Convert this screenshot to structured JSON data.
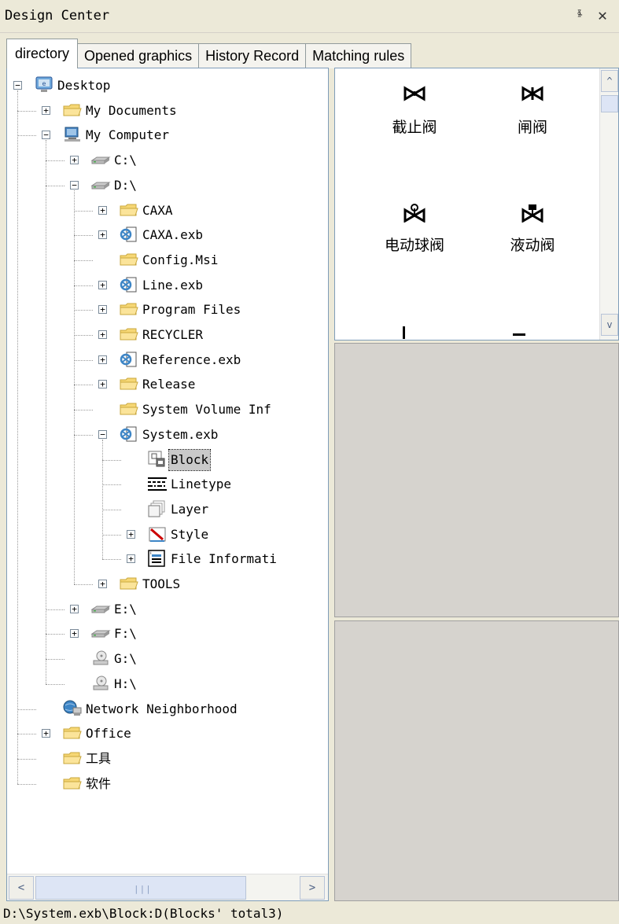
{
  "window": {
    "title": "Design Center",
    "pin_glyph": "ⱛ",
    "close_glyph": "✕"
  },
  "tabs": [
    {
      "label": "directory",
      "active": true
    },
    {
      "label": "Opened graphics",
      "active": false
    },
    {
      "label": "History Record",
      "active": false
    },
    {
      "label": "Matching rules",
      "active": false
    }
  ],
  "tree": [
    {
      "id": "desktop",
      "label": "Desktop",
      "icon": "desktop-icon",
      "level": 0,
      "expander": "minus"
    },
    {
      "id": "my-documents",
      "label": "My Documents",
      "icon": "folder-icon",
      "level": 1,
      "expander": "plus"
    },
    {
      "id": "my-computer",
      "label": "My Computer",
      "icon": "computer-icon",
      "level": 1,
      "expander": "minus"
    },
    {
      "id": "drive-c",
      "label": "C:\\",
      "icon": "drive-icon",
      "level": 2,
      "expander": "plus"
    },
    {
      "id": "drive-d",
      "label": "D:\\",
      "icon": "drive-icon",
      "level": 2,
      "expander": "minus"
    },
    {
      "id": "caxa",
      "label": "CAXA",
      "icon": "folder-icon",
      "level": 3,
      "expander": "plus"
    },
    {
      "id": "caxa-exb",
      "label": "CAXA.exb",
      "icon": "exb-file-icon",
      "level": 3,
      "expander": "plus"
    },
    {
      "id": "config-msi",
      "label": "Config.Msi",
      "icon": "folder-icon",
      "level": 3,
      "expander": "none"
    },
    {
      "id": "line-exb",
      "label": "Line.exb",
      "icon": "exb-file-icon",
      "level": 3,
      "expander": "plus"
    },
    {
      "id": "program-files",
      "label": "Program Files",
      "icon": "folder-icon",
      "level": 3,
      "expander": "plus"
    },
    {
      "id": "recycler",
      "label": "RECYCLER",
      "icon": "folder-icon",
      "level": 3,
      "expander": "plus"
    },
    {
      "id": "reference-exb",
      "label": "Reference.exb",
      "icon": "exb-file-icon",
      "level": 3,
      "expander": "plus"
    },
    {
      "id": "release",
      "label": "Release",
      "icon": "folder-icon",
      "level": 3,
      "expander": "plus"
    },
    {
      "id": "system-volume",
      "label": "System Volume Inf",
      "icon": "folder-icon",
      "level": 3,
      "expander": "none"
    },
    {
      "id": "system-exb",
      "label": "System.exb",
      "icon": "exb-file-icon",
      "level": 3,
      "expander": "minus"
    },
    {
      "id": "block",
      "label": "Block",
      "icon": "block-icon",
      "level": 4,
      "expander": "none",
      "selected": true
    },
    {
      "id": "linetype",
      "label": "Linetype",
      "icon": "linetype-icon",
      "level": 4,
      "expander": "none"
    },
    {
      "id": "layer",
      "label": "Layer",
      "icon": "layer-icon",
      "level": 4,
      "expander": "none"
    },
    {
      "id": "style",
      "label": "Style",
      "icon": "style-icon",
      "level": 4,
      "expander": "plus"
    },
    {
      "id": "file-info",
      "label": "File Informati",
      "icon": "file-info-icon",
      "level": 4,
      "expander": "plus"
    },
    {
      "id": "tools",
      "label": "TOOLS",
      "icon": "folder-icon",
      "level": 3,
      "expander": "plus"
    },
    {
      "id": "drive-e",
      "label": "E:\\",
      "icon": "drive-icon",
      "level": 2,
      "expander": "plus"
    },
    {
      "id": "drive-f",
      "label": "F:\\",
      "icon": "drive-icon",
      "level": 2,
      "expander": "plus"
    },
    {
      "id": "drive-g",
      "label": "G:\\",
      "icon": "cd-drive-icon",
      "level": 2,
      "expander": "none"
    },
    {
      "id": "drive-h",
      "label": "H:\\",
      "icon": "cd-drive-icon",
      "level": 2,
      "expander": "none"
    },
    {
      "id": "network",
      "label": "Network Neighborhood",
      "icon": "network-icon",
      "level": 1,
      "expander": "none"
    },
    {
      "id": "office",
      "label": "Office",
      "icon": "folder-icon",
      "level": 1,
      "expander": "plus"
    },
    {
      "id": "tools-cn",
      "label": "工具",
      "icon": "folder-icon",
      "level": 1,
      "expander": "none"
    },
    {
      "id": "software-cn",
      "label": "软件",
      "icon": "folder-icon",
      "level": 1,
      "expander": "none"
    }
  ],
  "hscroll": {
    "left_arrow": "<",
    "right_arrow": ">",
    "grip": "|||"
  },
  "vscroll": {
    "up_arrow": "^",
    "down_arrow": "v"
  },
  "preview_items": [
    {
      "label": "截止阀",
      "icon": "globe-valve-icon"
    },
    {
      "label": "闸阀",
      "icon": "gate-valve-icon"
    },
    {
      "label": "电动球阀",
      "icon": "electric-ball-valve-icon"
    },
    {
      "label": "液动阀",
      "icon": "hydraulic-valve-icon"
    }
  ],
  "status": {
    "text": "D:\\System.exb\\Block:D(Blocks' total3)"
  }
}
